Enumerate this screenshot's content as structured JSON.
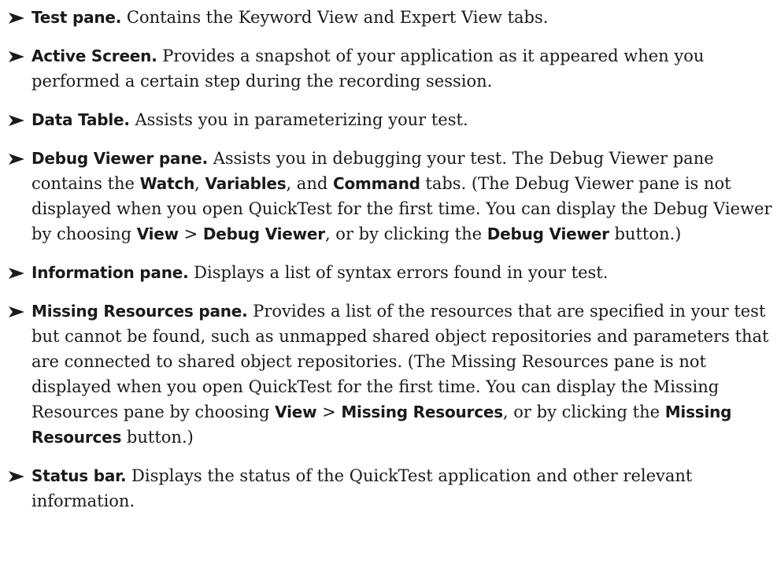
{
  "items": [
    {
      "term": "Test pane.",
      "text": " Contains the Keyword View and Expert View tabs."
    },
    {
      "term": "Active Screen.",
      "text": " Provides a snapshot of your application as it appeared when you performed a certain step during the recording session."
    },
    {
      "term": "Data Table.",
      "text": " Assists you in parameterizing your test."
    },
    {
      "term": "Debug Viewer pane.",
      "t1": " Assists you in debugging your test. The Debug Viewer pane contains the ",
      "b1": "Watch",
      "t2": ", ",
      "b2": "Variables",
      "t3": ", and ",
      "b3": "Command",
      "t4": " tabs. (The Debug Viewer pane is not displayed when you open QuickTest for the first time. You can display the Debug Viewer by choosing ",
      "b4": "View",
      "t5": " > ",
      "b5": "Debug Viewer",
      "t6": ", or by clicking the ",
      "b6": "Debug Viewer",
      "t7": " button.)"
    },
    {
      "term": "Information pane.",
      "text": " Displays a list of syntax errors found in your test."
    },
    {
      "term": "Missing Resources pane.",
      "t1": " Provides a list of the resources that are specified in your test but cannot be found, such as unmapped shared object repositories and parameters that are connected to shared object repositories. (The Missing Resources pane is not displayed when you open QuickTest for the first time. You can display the Missing Resources pane by choosing ",
      "b1": "View",
      "t2": " > ",
      "b2": "Missing Resources",
      "t3": ", or by clicking the ",
      "b3": "Missing Resources",
      "t4": " button.)"
    },
    {
      "term": "Status bar.",
      "text": " Displays the status of the QuickTest application and other relevant information."
    }
  ]
}
